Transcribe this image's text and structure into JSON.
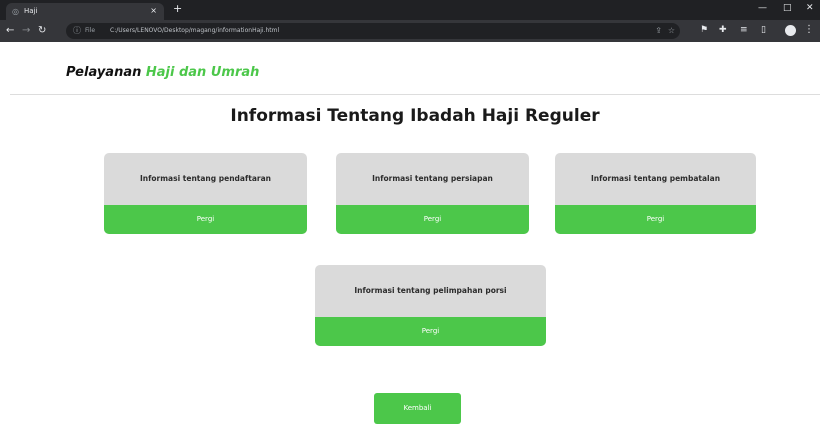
{
  "browser": {
    "tab_title": "Haji",
    "tab_close": "×",
    "new_tab": "+",
    "window_controls": {
      "minimize": "—",
      "maximize": "□",
      "close": "✕"
    },
    "nav": {
      "back": "←",
      "forward": "→",
      "reload": "↻"
    },
    "address": {
      "protocol_label": "File",
      "url": "C:/Users/LENOVO/Desktop/magang/informationHaji.html"
    },
    "icons": {
      "tab_favicon": "globe-icon",
      "info": "info-icon",
      "share": "share-icon",
      "bookmark": "star-icon",
      "extension1": "extension-icon",
      "extension2": "puzzle-icon",
      "reading_list": "list-icon",
      "sidebar": "sidebar-icon",
      "profile": "profile-icon",
      "menu": "more-vert-icon"
    }
  },
  "header": {
    "brand_part1": "Pelayanan",
    "brand_part2": "Haji dan Umrah"
  },
  "main": {
    "title": "Informasi Tentang Ibadah Haji Reguler",
    "cards": [
      {
        "title": "Informasi tentang pendaftaran",
        "button": "Pergi"
      },
      {
        "title": "Informasi tentang persiapan",
        "button": "Pergi"
      },
      {
        "title": "Informasi tentang pembatalan",
        "button": "Pergi"
      },
      {
        "title": "Informasi tentang pelimpahan porsi",
        "button": "Pergi"
      }
    ],
    "back_button": "Kembali"
  },
  "colors": {
    "accent_green": "#4cc74a",
    "card_gray": "#dadada",
    "chrome_dark": "#202124",
    "chrome_toolbar": "#35363a"
  }
}
